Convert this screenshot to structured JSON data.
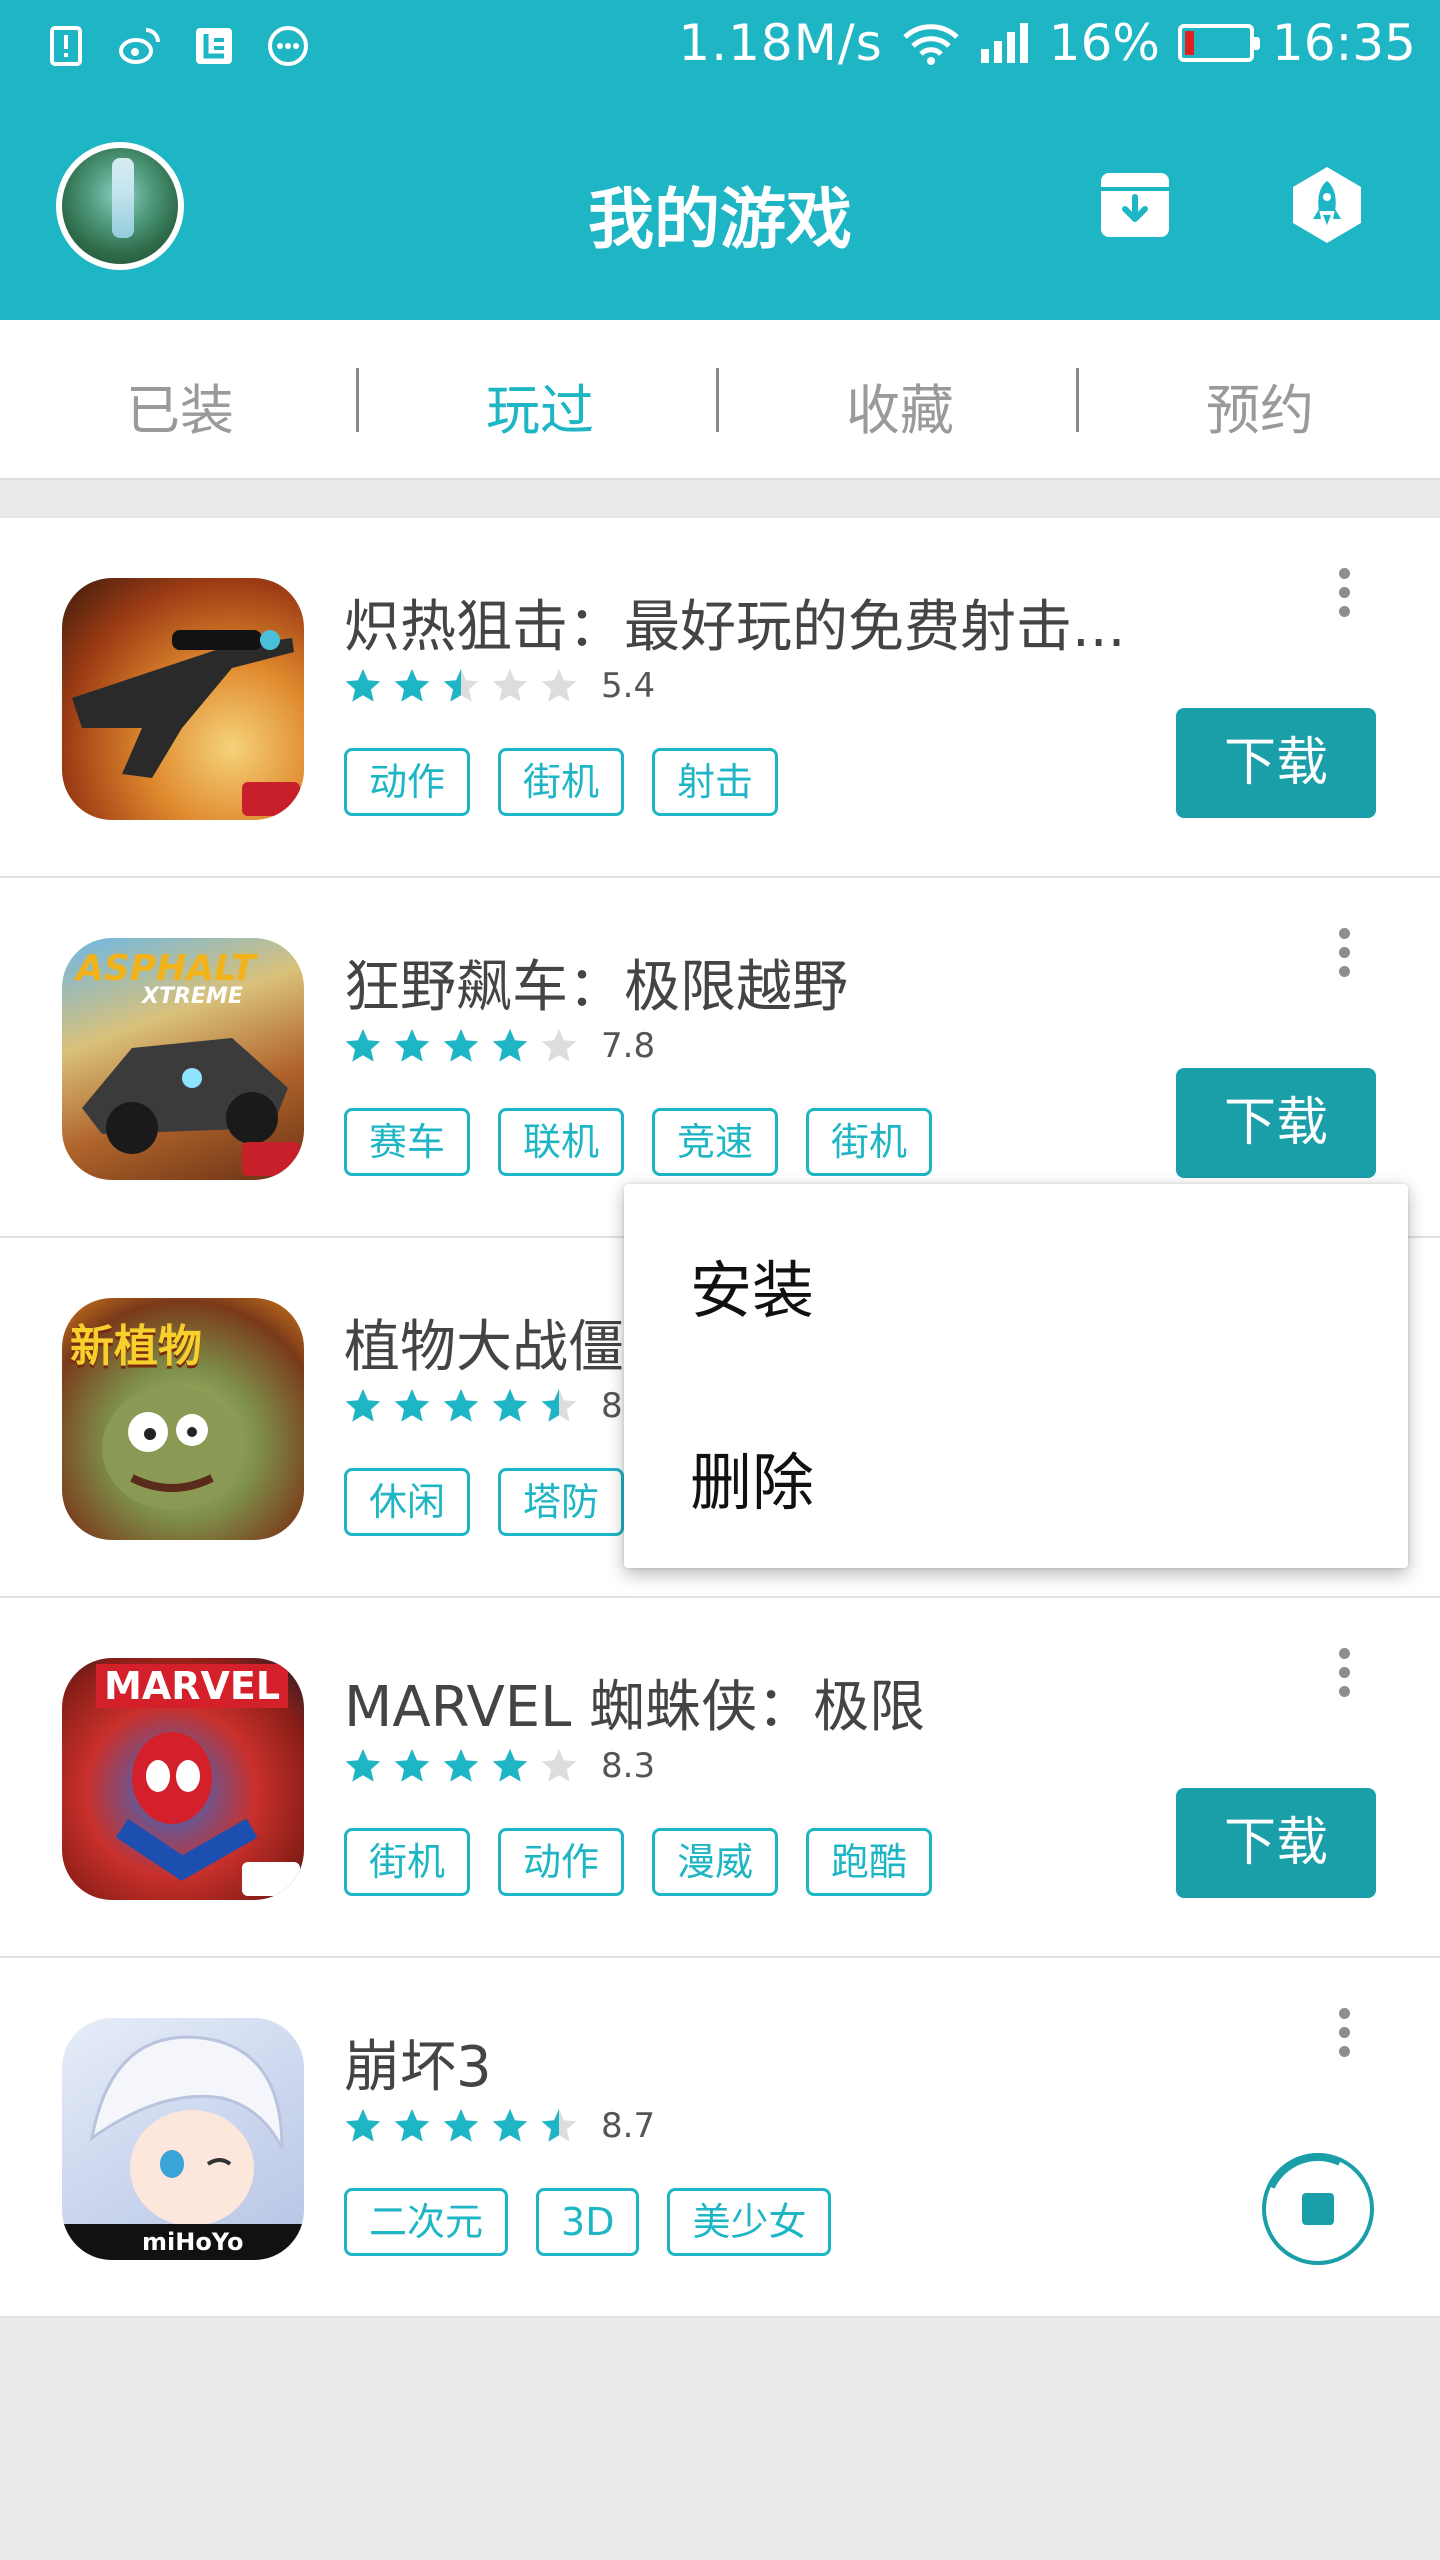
{
  "status_bar": {
    "net_speed": "1.18M/s",
    "battery_percent": "16%",
    "time": "16:35",
    "icons": [
      "sim-alert-icon",
      "weibo-icon",
      "letv-icon",
      "more-dots-icon",
      "wifi-icon",
      "signal-icon",
      "battery-icon"
    ]
  },
  "header": {
    "title": "我的游戏",
    "background_color": "#1eb5c4",
    "actions": [
      "download-manager-icon",
      "rocket-icon"
    ]
  },
  "tabs": [
    {
      "label": "已装",
      "active": false
    },
    {
      "label": "玩过",
      "active": true
    },
    {
      "label": "收藏",
      "active": false
    },
    {
      "label": "预约",
      "active": false
    }
  ],
  "games": [
    {
      "name": "炽热狙击：最好玩的免费射击...",
      "rating": 2.5,
      "score": "5.4",
      "tags": [
        "动作",
        "街机",
        "射击"
      ],
      "action": "下载",
      "art_text": ""
    },
    {
      "name": "狂野飙车：极限越野",
      "rating": 4,
      "score": "7.8",
      "tags": [
        "赛车",
        "联机",
        "竞速",
        "街机"
      ],
      "action": "下载",
      "art_text": "ASPHALT",
      "art_subtext": "XTREME"
    },
    {
      "name": "植物大战僵",
      "rating": 4.5,
      "score": "8.",
      "tags": [
        "休闲",
        "塔防"
      ],
      "action": "",
      "art_text": "新植物"
    },
    {
      "name": "MARVEL 蜘蛛侠：极限",
      "rating": 4,
      "score": "8.3",
      "tags": [
        "街机",
        "动作",
        "漫威",
        "跑酷"
      ],
      "action": "下载",
      "art_text": "MARVEL"
    },
    {
      "name": "崩坏3",
      "rating": 4.5,
      "score": "8.7",
      "tags": [
        "二次元",
        "3D",
        "美少女"
      ],
      "action": "pause",
      "art_text": "miHoYo"
    }
  ],
  "context_menu": {
    "items": [
      "安装",
      "删除"
    ]
  },
  "colors": {
    "accent": "#1eb5c4",
    "button": "#1a9fa9",
    "star_filled": "#1eb5c4",
    "star_empty": "#dddddd"
  }
}
